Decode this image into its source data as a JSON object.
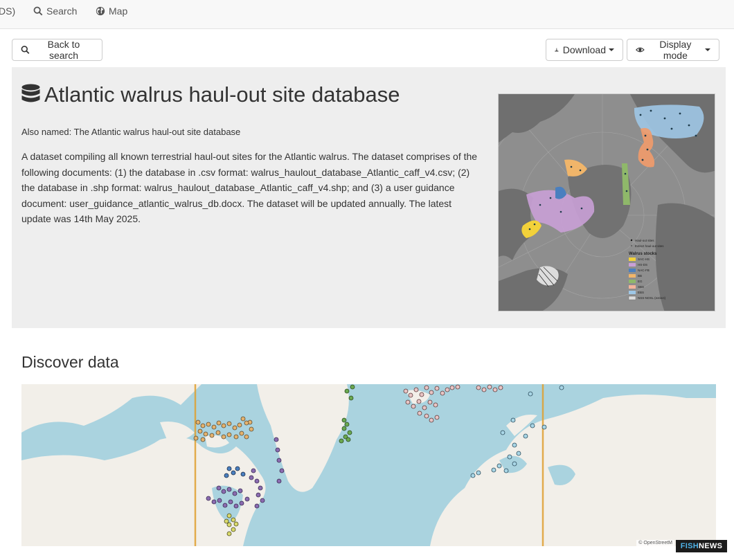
{
  "nav": {
    "partial_item": "DS)",
    "search_label": "Search",
    "map_label": "Map"
  },
  "toolbar": {
    "back_label": "Back to search",
    "download_label": "Download",
    "display_mode_label": "Display mode"
  },
  "record": {
    "title": "Atlantic walrus haul-out site database",
    "also_named": "Also named: The Atlantic walrus haul-out site database",
    "description": "A dataset compiling all known terrestrial haul-out sites for the Atlantic walrus. The dataset comprises of the following documents: (1) the database in .csv format: walrus_haulout_database_Atlantic_caff_v4.csv; (2) the database in .shp format: walrus_haulout_database_Atlantic_caff_v4.shp; and (3) a user guidance document: user_guidance_atlantic_walrus_db.docx. The dataset will be updated annually. The latest update was 14th May 2025."
  },
  "thumbnail": {
    "legend_title": "Walrus stocks",
    "legend_symbols": [
      "Haul-out sites",
      "Extinct haul-out sites"
    ],
    "legend_items": [
      {
        "label": "SAC-HS",
        "color": "#f2d13a"
      },
      {
        "label": "HS-DS",
        "color": "#c9a0d6"
      },
      {
        "label": "NAC-FB",
        "color": "#4a7fbf"
      },
      {
        "label": "BB",
        "color": "#f0b56a"
      },
      {
        "label": "EG",
        "color": "#8fb86a"
      },
      {
        "label": "SBS",
        "color": "#f4b39a"
      },
      {
        "label": "EBS",
        "color": "#9ec7e6"
      },
      {
        "label": "NSS-NOSL (extinct)",
        "color": "#dddddd"
      }
    ]
  },
  "discover": {
    "heading": "Discover data"
  },
  "map": {
    "attribution": "© OpenStreetM"
  },
  "watermark": {
    "part1": "FISH",
    "part2": "NEWS"
  },
  "colors": {
    "nav_bg": "#f8f8f8",
    "hero_bg": "#eeeeee",
    "ocean": "#aad3df",
    "land": "#f2efe9",
    "meridian": "#e0a030"
  }
}
